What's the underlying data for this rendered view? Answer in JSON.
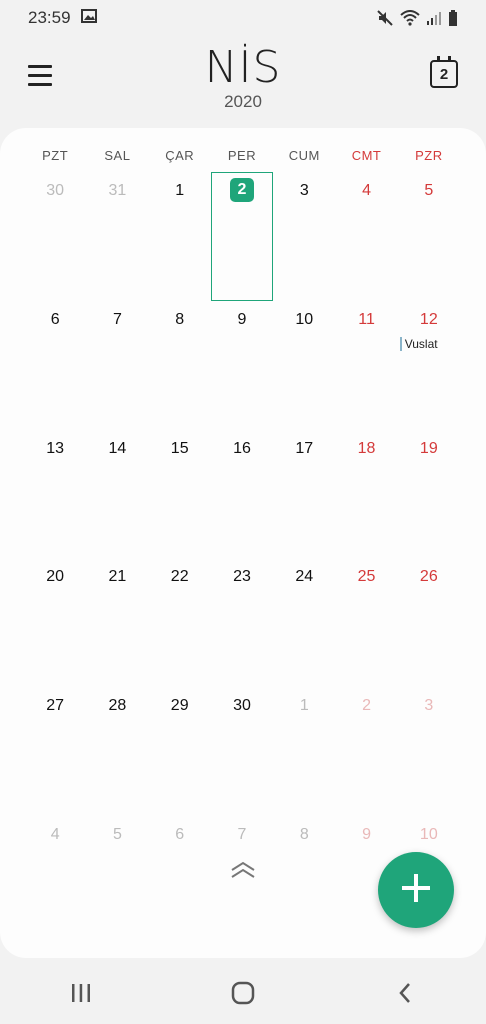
{
  "status_bar": {
    "time": "23:59"
  },
  "header": {
    "month": "NİS",
    "year": "2020",
    "today_day": "2"
  },
  "weekdays": [
    "PZT",
    "SAL",
    "ÇAR",
    "PER",
    "CUM",
    "CMT",
    "PZR"
  ],
  "weeks": [
    [
      {
        "day": "30",
        "muted": true
      },
      {
        "day": "31",
        "muted": true
      },
      {
        "day": "1"
      },
      {
        "day": "2",
        "today": true
      },
      {
        "day": "3"
      },
      {
        "day": "4",
        "weekend": true
      },
      {
        "day": "5",
        "weekend": true
      }
    ],
    [
      {
        "day": "6"
      },
      {
        "day": "7"
      },
      {
        "day": "8"
      },
      {
        "day": "9"
      },
      {
        "day": "10"
      },
      {
        "day": "11",
        "weekend": true
      },
      {
        "day": "12",
        "weekend": true,
        "event": "Vuslat"
      }
    ],
    [
      {
        "day": "13"
      },
      {
        "day": "14"
      },
      {
        "day": "15"
      },
      {
        "day": "16"
      },
      {
        "day": "17"
      },
      {
        "day": "18",
        "weekend": true
      },
      {
        "day": "19",
        "weekend": true
      }
    ],
    [
      {
        "day": "20"
      },
      {
        "day": "21"
      },
      {
        "day": "22"
      },
      {
        "day": "23"
      },
      {
        "day": "24"
      },
      {
        "day": "25",
        "weekend": true
      },
      {
        "day": "26",
        "weekend": true
      }
    ],
    [
      {
        "day": "27"
      },
      {
        "day": "28"
      },
      {
        "day": "29"
      },
      {
        "day": "30"
      },
      {
        "day": "1",
        "muted": true
      },
      {
        "day": "2",
        "muted": true,
        "weekend": true
      },
      {
        "day": "3",
        "muted": true,
        "weekend": true
      }
    ],
    [
      {
        "day": "4",
        "muted": true
      },
      {
        "day": "5",
        "muted": true
      },
      {
        "day": "6",
        "muted": true
      },
      {
        "day": "7",
        "muted": true
      },
      {
        "day": "8",
        "muted": true
      },
      {
        "day": "9",
        "muted": true,
        "weekend": true
      },
      {
        "day": "10",
        "muted": true,
        "weekend": true
      }
    ]
  ],
  "icons": {
    "menu": "hamburger-menu-icon",
    "today": "calendar-today-icon",
    "collapse": "double-chevron-up-icon",
    "fab": "plus-icon"
  },
  "colors": {
    "accent": "#1fa57a",
    "weekend": "#d43a3a"
  }
}
